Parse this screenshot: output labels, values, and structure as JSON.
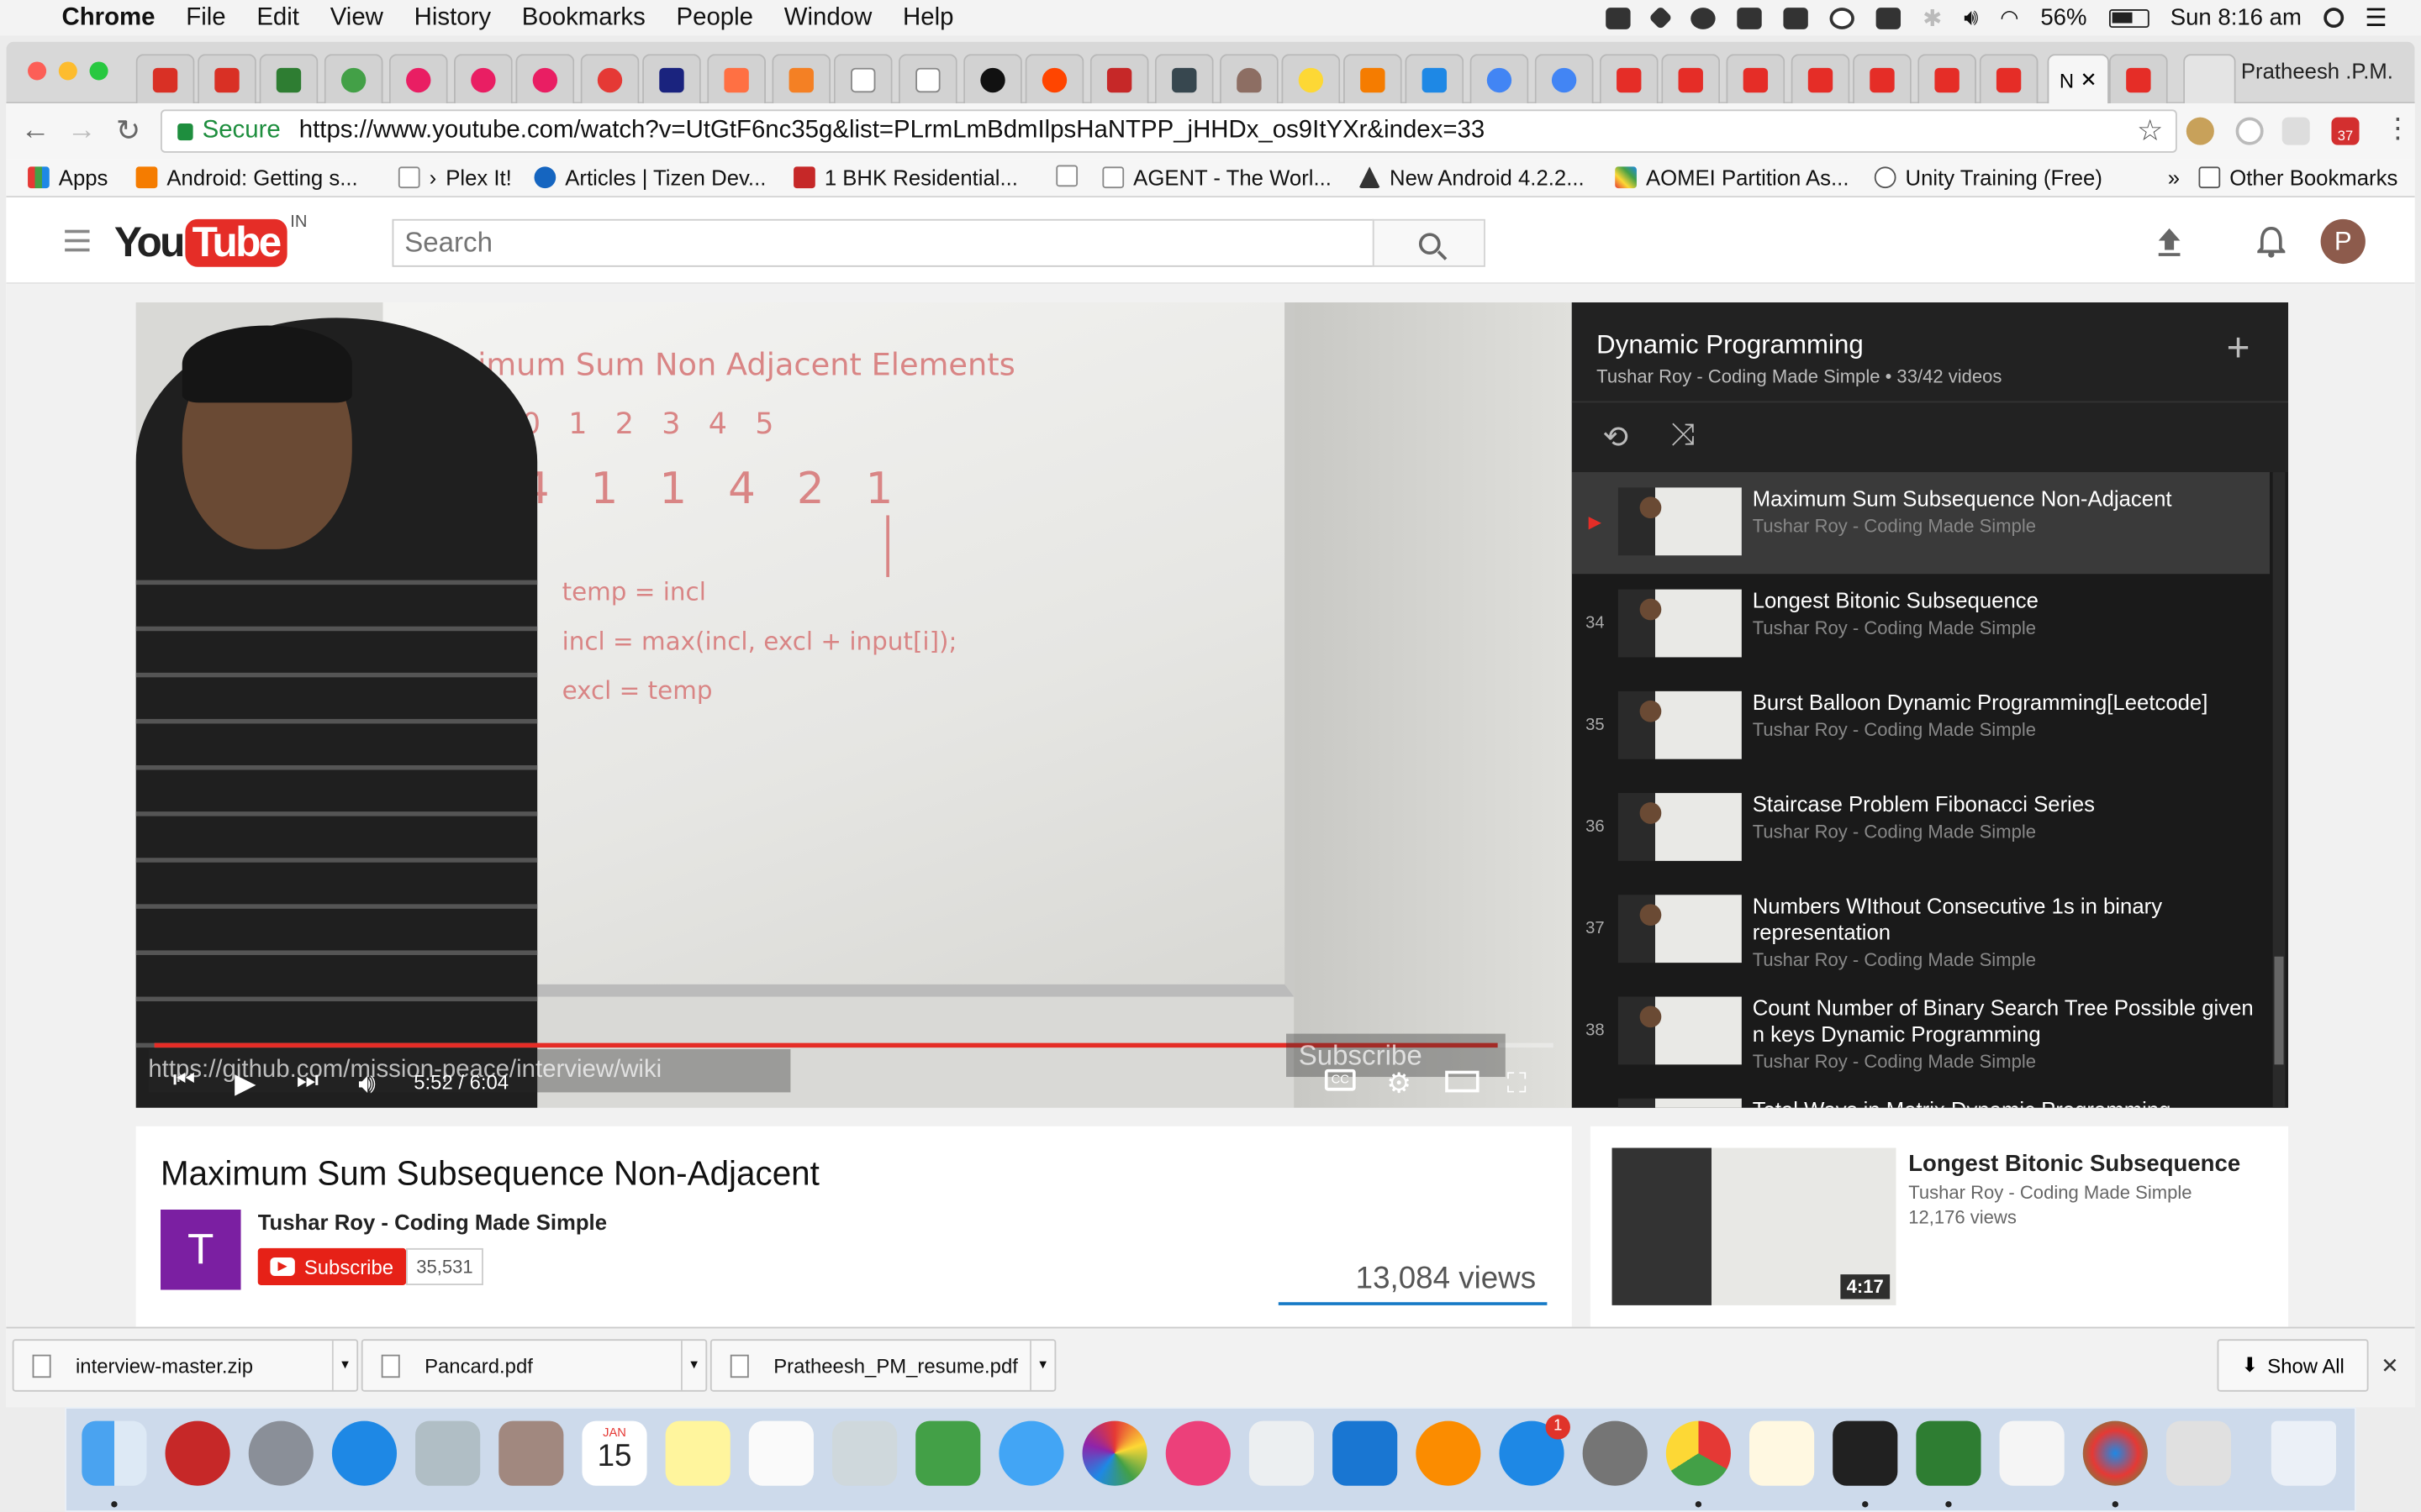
{
  "menubar": {
    "app_name": "Chrome",
    "menus": [
      "File",
      "Edit",
      "View",
      "History",
      "Bookmarks",
      "People",
      "Window",
      "Help"
    ],
    "battery": "56%",
    "clock": "Sun 8:16 am"
  },
  "browser": {
    "active_tab_label": "N",
    "profile_name": "Pratheesh .P.M.",
    "secure_label": "Secure",
    "url": "https://www.youtube.com/watch?v=UtGtF6nc35g&list=PLrmLmBdmIlpsHaNTPP_jHHDx_os9ItYXr&index=33",
    "calendar_badge": "37",
    "bookmarks": [
      "Apps",
      "Android: Getting s...",
      "Plex It!",
      "Articles | Tizen Dev...",
      "1 BHK Residential...",
      "",
      "AGENT - The Worl...",
      "New Android 4.2.2...",
      "AOMEI Partition As...",
      "Unity Training (Free)"
    ],
    "other_bookmarks": "Other Bookmarks"
  },
  "youtube": {
    "logo_you": "You",
    "logo_tube": "Tube",
    "logo_region": "IN",
    "search_placeholder": "Search",
    "avatar_letter": "P"
  },
  "player": {
    "whiteboard_title": "Maximum Sum Non Adjacent Elements",
    "whiteboard_indices": "0   1   2   3   4   5",
    "whiteboard_values": "4   1   1   4   2   1",
    "whiteboard_line1": "temp = incl",
    "whiteboard_line2": "incl = max(incl, excl + input[i]);",
    "whiteboard_line3": "excl = temp",
    "annotation_url": "https://github.com/mission-peace/interview/wiki",
    "annotation_subscribe": "Subscribe",
    "time": "5:52 / 6:04",
    "progress": 0.96
  },
  "playlist": {
    "title": "Dynamic Programming",
    "subtitle": "Tushar Roy - Coding Made Simple • 33/42 videos",
    "items": [
      {
        "num": "▶",
        "title": "Maximum Sum Subsequence Non-Adjacent",
        "channel": "Tushar Roy - Coding Made Simple"
      },
      {
        "num": "34",
        "title": "Longest Bitonic Subsequence",
        "channel": "Tushar Roy - Coding Made Simple"
      },
      {
        "num": "35",
        "title": "Burst Balloon Dynamic Programming[Leetcode]",
        "channel": "Tushar Roy - Coding Made Simple"
      },
      {
        "num": "36",
        "title": "Staircase Problem Fibonacci Series",
        "channel": "Tushar Roy - Coding Made Simple"
      },
      {
        "num": "37",
        "title": "Numbers WIthout Consecutive 1s in binary representation",
        "channel": "Tushar Roy - Coding Made Simple"
      },
      {
        "num": "38",
        "title": "Count Number of Binary Search Tree Possible given n keys Dynamic Programming",
        "channel": "Tushar Roy - Coding Made Simple"
      },
      {
        "num": "",
        "title": "Total Ways in Matrix Dynamic Programming",
        "channel": ""
      }
    ]
  },
  "video": {
    "title": "Maximum Sum Subsequence Non-Adjacent",
    "channel_initial": "T",
    "channel_name": "Tushar Roy - Coding Made Simple",
    "subscribe_label": "Subscribe",
    "subscriber_count": "35,531",
    "views": "13,084 views"
  },
  "related": {
    "title": "Longest Bitonic Subsequence",
    "channel": "Tushar Roy - Coding Made Simple",
    "views": "12,176 views",
    "duration": "4:17"
  },
  "downloads": {
    "files": [
      "interview-master.zip",
      "Pancard.pdf",
      "Pratheesh_PM_resume.pdf"
    ],
    "show_all": "Show All"
  },
  "dock": {
    "calendar_month": "JAN",
    "calendar_day": "15",
    "appstore_badge": "1"
  }
}
